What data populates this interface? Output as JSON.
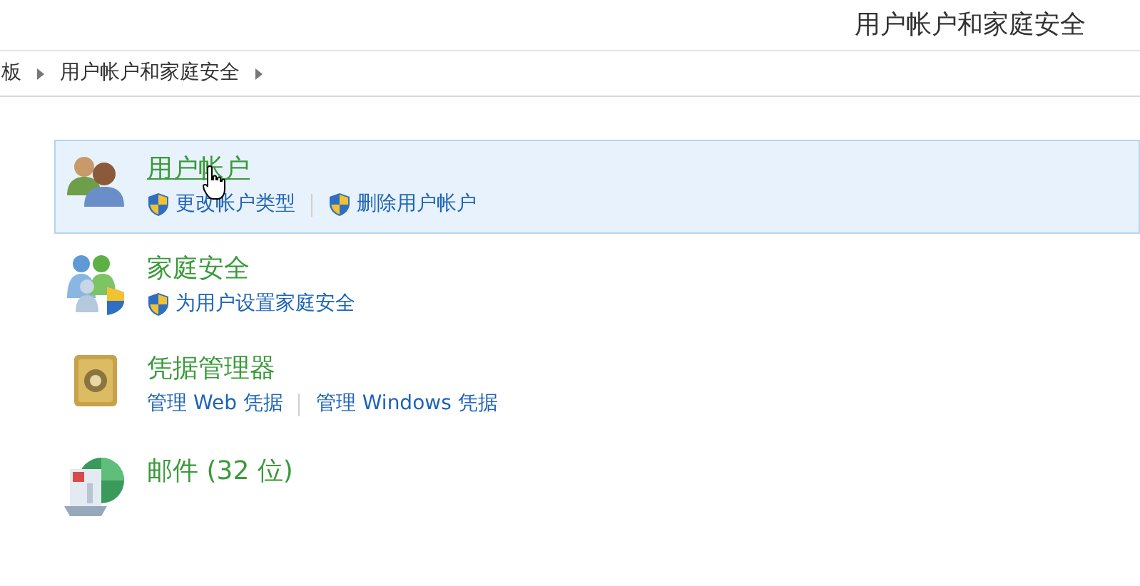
{
  "window": {
    "title": "用户帐户和家庭安全"
  },
  "breadcrumb": [
    "板",
    "用户帐户和家庭安全"
  ],
  "categories": [
    {
      "title": "用户帐户",
      "hovered": true,
      "links": [
        {
          "label": "更改帐户类型",
          "shield": true
        },
        {
          "label": "删除用户帐户",
          "shield": true
        }
      ]
    },
    {
      "title": "家庭安全",
      "hovered": false,
      "links": [
        {
          "label": "为用户设置家庭安全",
          "shield": true
        }
      ]
    },
    {
      "title": "凭据管理器",
      "hovered": false,
      "links": [
        {
          "label": "管理 Web 凭据",
          "shield": false
        },
        {
          "label": "管理 Windows 凭据",
          "shield": false
        }
      ]
    },
    {
      "title": "邮件 (32 位)",
      "hovered": false
    }
  ]
}
